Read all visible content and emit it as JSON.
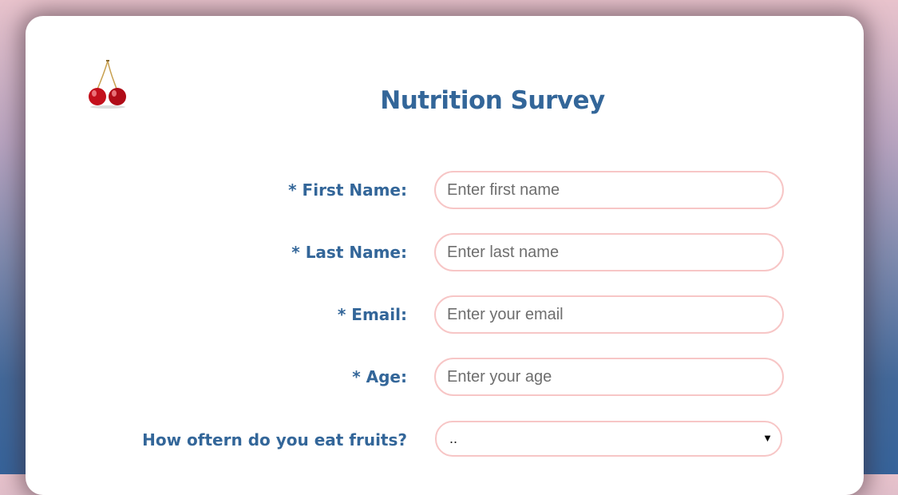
{
  "survey": {
    "title": "Nutrition Survey",
    "fields": [
      {
        "label": "* First Name:",
        "placeholder": "Enter first name",
        "value": ""
      },
      {
        "label": "* Last Name:",
        "placeholder": "Enter last name",
        "value": ""
      },
      {
        "label": "* Email:",
        "placeholder": "Enter your email",
        "value": ""
      },
      {
        "label": "* Age:",
        "placeholder": "Enter your age",
        "value": ""
      }
    ],
    "fruit_question": {
      "label": "How oftern do you eat fruits?",
      "selected": "..",
      "arrow_icon": "triangle-down-icon"
    },
    "logo_icon": "cherries-icon"
  },
  "colors": {
    "heading": "#336699",
    "field_border": "#f7c6c6",
    "card": "#ffffff"
  }
}
